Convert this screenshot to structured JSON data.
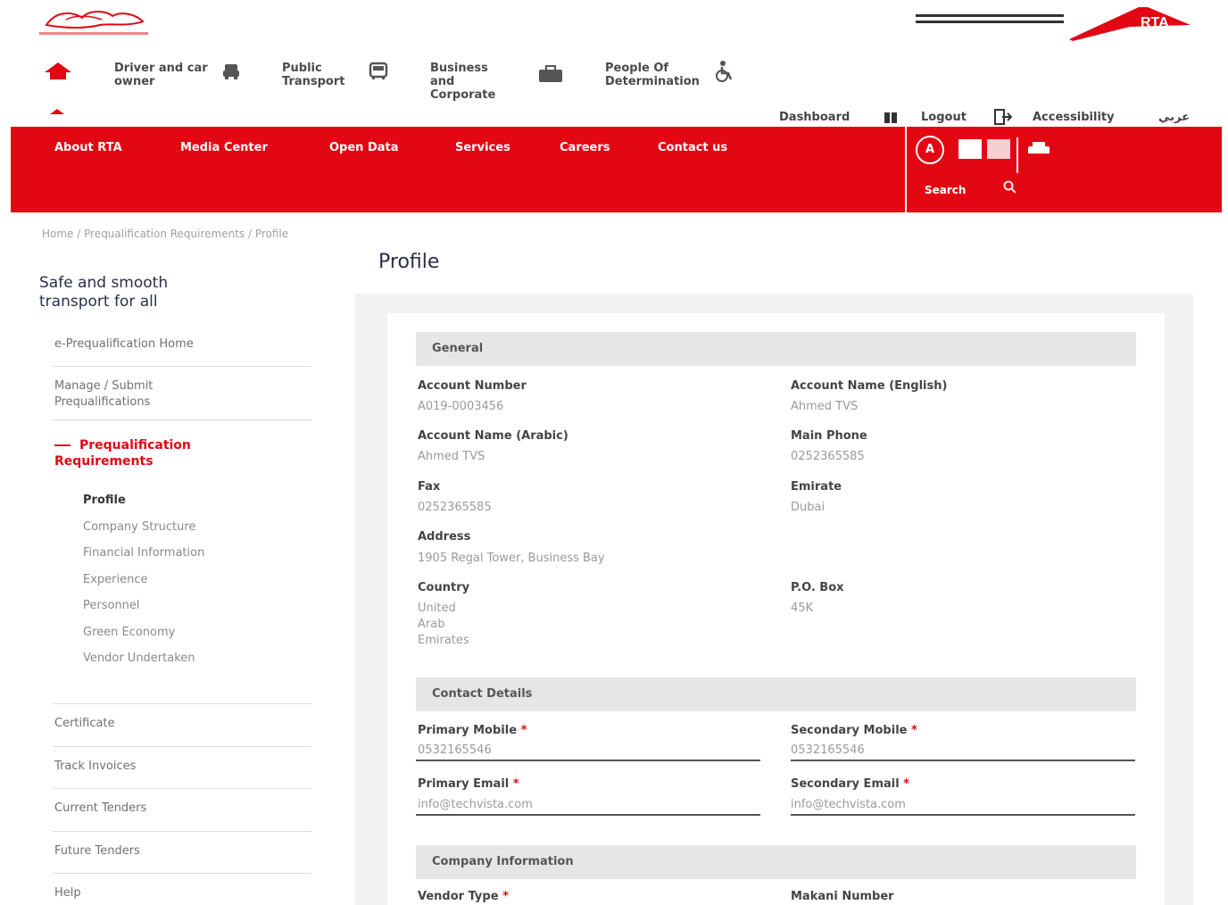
{
  "header": {
    "logo_left_alt": "Government of Dubai",
    "logo_right_text": "RTA",
    "categories": [
      {
        "label": "Driver and car owner",
        "icon": "car-icon"
      },
      {
        "label": "Public Transport",
        "icon": "bus-icon"
      },
      {
        "label": "Business and Corporate",
        "icon": "briefcase-icon"
      },
      {
        "label": "People Of Determination",
        "icon": "wheelchair-icon"
      }
    ],
    "utility": {
      "dashboard": "Dashboard",
      "logout": "Logout",
      "accessibility": "Accessibility",
      "arabic": "عربي"
    }
  },
  "navbar": {
    "links": [
      "About RTA",
      "Media Center",
      "Open Data",
      "Services",
      "Careers",
      "Contact us"
    ],
    "accessibility_a": "A",
    "search_label": "Search",
    "bg_color": "#e30613"
  },
  "breadcrumb": "Home / Prequalification Requirements / Profile",
  "page": {
    "title": "Profile"
  },
  "sidebar": {
    "tagline": "Safe and smooth transport for all",
    "items_top": [
      "e-Prequalification Home",
      "Manage / Submit Prequalifications"
    ],
    "active": "Prequalification Requirements",
    "sub_items": [
      "Profile",
      "Company Structure",
      "Financial Information",
      "Experience",
      "Personnel",
      "Green Economy",
      "Vendor Undertaken"
    ],
    "items_bottom": [
      "Certificate",
      "Track Invoices",
      "Current Tenders",
      "Future Tenders",
      "Help"
    ]
  },
  "general": {
    "heading": "General",
    "account_number": {
      "label": "Account Number",
      "value": "A019-0003456"
    },
    "account_name_en": {
      "label": "Account Name (English)",
      "value": "Ahmed TVS"
    },
    "account_name_ar": {
      "label": "Account Name (Arabic)",
      "value": "Ahmed TVS"
    },
    "main_phone": {
      "label": "Main Phone",
      "value": "0252365585"
    },
    "fax": {
      "label": "Fax",
      "value": "0252365585"
    },
    "emirate": {
      "label": "Emirate",
      "value": "Dubai"
    },
    "address": {
      "label": "Address",
      "value": "1905 Regal Tower, Business Bay"
    },
    "country": {
      "label": "Country",
      "value": [
        "United",
        "Arab",
        "Emirates"
      ]
    },
    "po_box": {
      "label": "P.O. Box",
      "value": "45K"
    }
  },
  "contact": {
    "heading": "Contact Details",
    "primary_mobile": {
      "label": "Primary Mobile",
      "value": "0532165546"
    },
    "secondary_mobile": {
      "label": "Secondary Mobile",
      "value": "0532165546"
    },
    "primary_email": {
      "label": "Primary Email",
      "value": "info@techvista.com"
    },
    "secondary_email": {
      "label": "Secondary Email",
      "value": "info@techvista.com"
    }
  },
  "company": {
    "heading": "Company Information",
    "vendor_type": {
      "label": "Vendor Type"
    },
    "makani": {
      "label": "Makani Number"
    }
  }
}
